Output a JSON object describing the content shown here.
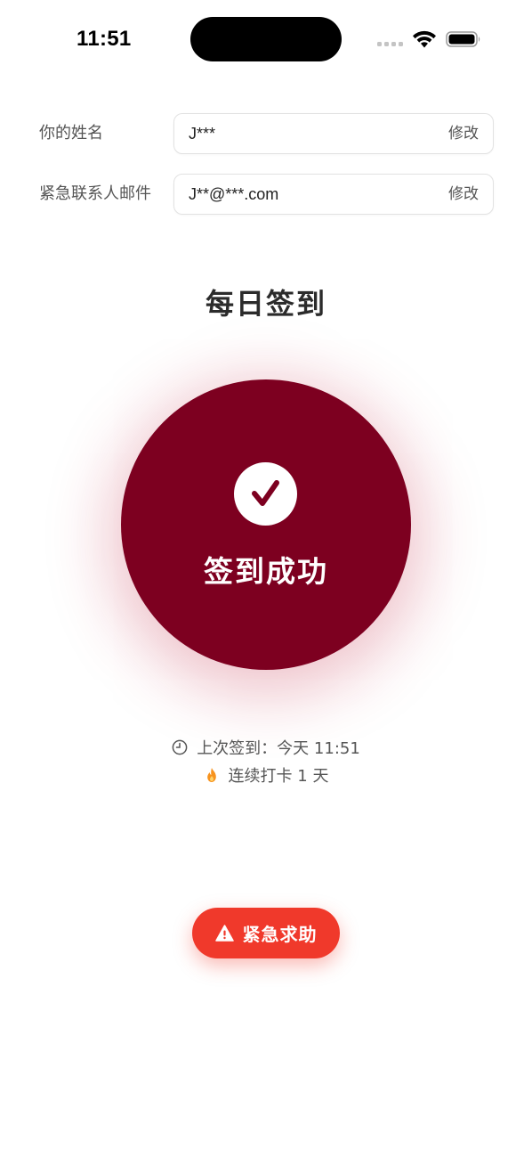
{
  "status_bar": {
    "time": "11:51",
    "icons": [
      "cellular-signal-icon",
      "wifi-icon",
      "battery-icon"
    ]
  },
  "profile": {
    "name": {
      "label": "你的姓名",
      "value": "J***",
      "edit_label": "修改"
    },
    "emergency_email": {
      "label": "紧急联系人邮件",
      "value": "J**@***.com",
      "edit_label": "修改"
    }
  },
  "checkin": {
    "title": "每日签到",
    "status_label": "签到成功",
    "last_checkin": "上次签到：今天 11:51",
    "streak": "连续打卡 1 天",
    "icons": [
      "check-icon",
      "clock-icon",
      "flame-icon"
    ]
  },
  "emergency": {
    "button_label": "紧急求助",
    "icon": "warning-icon"
  },
  "colors": {
    "checkin_circle": "#7d0020",
    "emergency_button": "#f0392b",
    "flame": "#f7931e"
  }
}
